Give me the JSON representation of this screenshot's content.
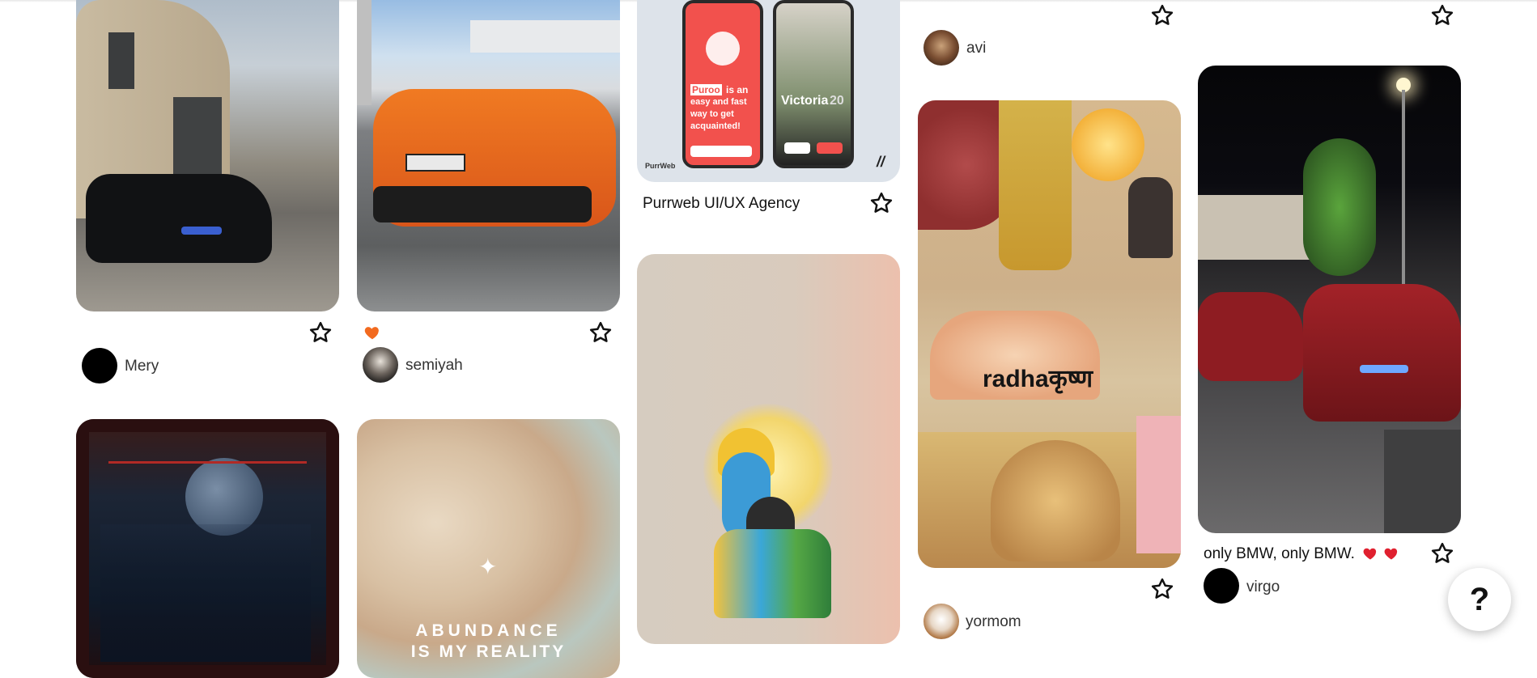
{
  "pins": [
    {
      "user": "Mery"
    },
    {
      "user": "semiyah"
    },
    {
      "title": "Purrweb UI/UX Agency",
      "overlay": [
        "Puroo",
        "is an",
        "easy and fast",
        "way to get",
        "acquainted!"
      ],
      "phone_name": "Victoria",
      "phone_age": "20",
      "brand": "PurrWeb",
      "mark": "//"
    },
    {
      "user": "avi"
    },
    {
      "user": "yormom",
      "overlay": "radhaकृष्ण"
    },
    {
      "title": "only BMW, only BMW.",
      "user": "virgo"
    },
    {
      "overlay": [
        "ABUNDANCE",
        "IS MY REALITY"
      ]
    }
  ],
  "help_label": "?",
  "colors": {
    "accent_heart": "#f26a1f",
    "red_heart": "#e0202f"
  }
}
